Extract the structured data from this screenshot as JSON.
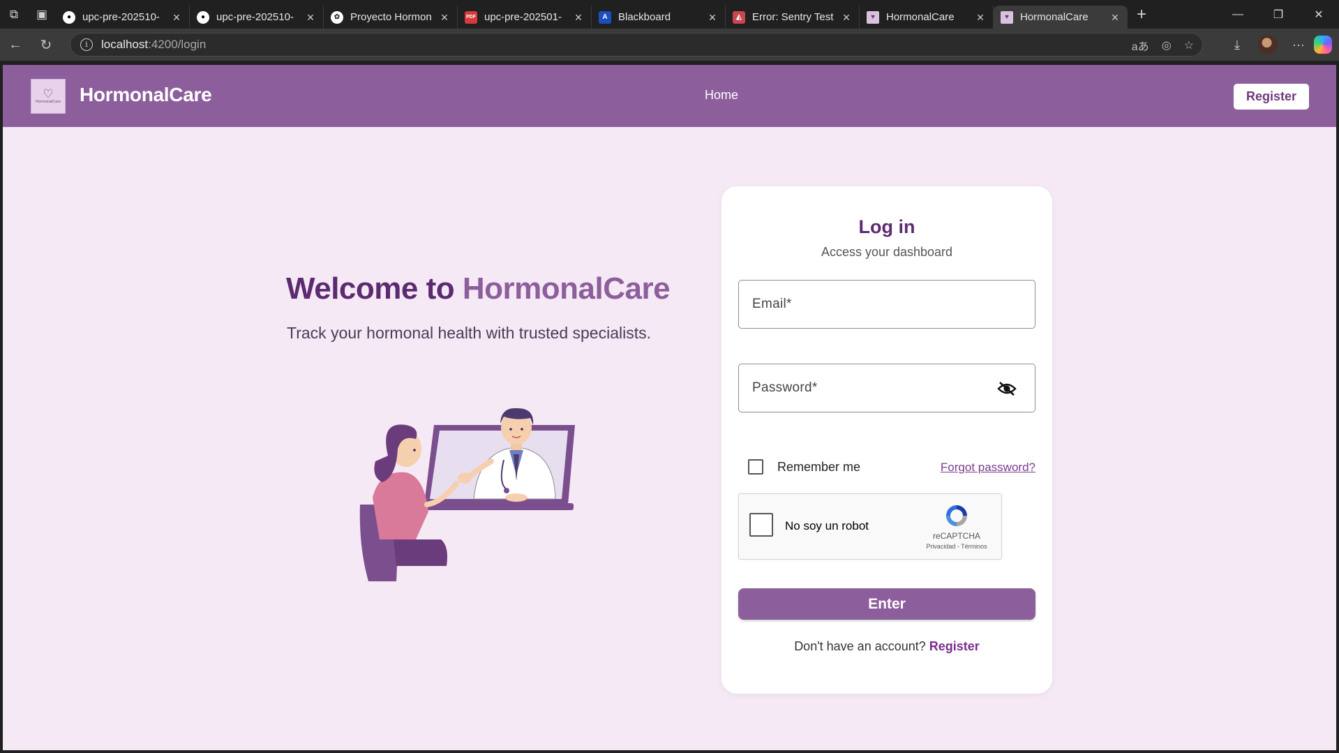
{
  "browser": {
    "tabs": [
      {
        "title": "upc-pre-202510-",
        "icon": "github-icon",
        "active": false
      },
      {
        "title": "upc-pre-202510-",
        "icon": "github-icon",
        "active": false
      },
      {
        "title": "Proyecto Hormon",
        "icon": "chatgpt-icon",
        "active": false
      },
      {
        "title": "upc-pre-202501-",
        "icon": "pdf-icon",
        "active": false
      },
      {
        "title": "Blackboard",
        "icon": "blackboard-icon",
        "active": false
      },
      {
        "title": "Error: Sentry Test",
        "icon": "sentry-icon",
        "active": false
      },
      {
        "title": "HormonalCare",
        "icon": "hormonalcare-icon",
        "active": false
      },
      {
        "title": "HormonalCare",
        "icon": "hormonalcare-icon",
        "active": true
      }
    ],
    "url_host": "localhost",
    "url_rest": ":4200/login"
  },
  "header": {
    "logo_text": "HormonalCare",
    "brand": "HormonalCare",
    "nav_home": "Home",
    "register_button": "Register"
  },
  "hero": {
    "title_prefix": "Welcome to ",
    "title_accent": "HormonalCare",
    "subtitle": "Track your hormonal health with trusted specialists."
  },
  "login": {
    "title": "Log in",
    "subtitle": "Access your dashboard",
    "email_label": "Email*",
    "password_label": "Password*",
    "remember_label": "Remember me",
    "forgot_link": "Forgot password?",
    "captcha_text": "No soy un robot",
    "captcha_brand": "reCAPTCHA",
    "captcha_terms": "Privacidad - Términos",
    "enter_button": "Enter",
    "signup_prompt": "Don't have an account?",
    "signup_link": "Register"
  },
  "colors": {
    "brand": "#8d5e9c",
    "brand_dark": "#5c2a70",
    "background": "#f5e9f5"
  }
}
